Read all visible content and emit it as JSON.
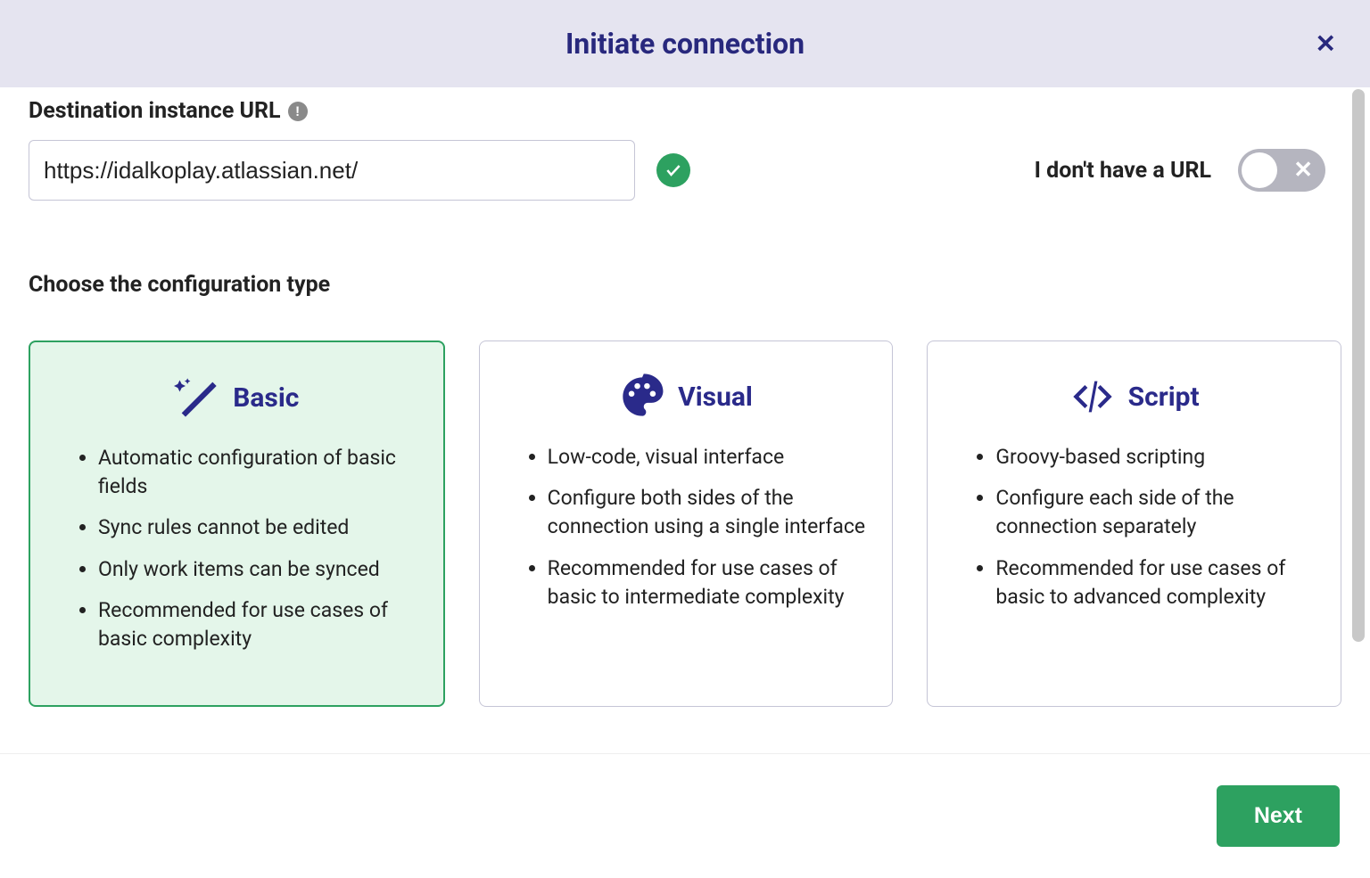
{
  "header": {
    "title": "Initiate connection"
  },
  "url_section": {
    "label": "Destination instance URL",
    "value": "https://idalkoplay.atlassian.net/",
    "no_url_label": "I don't have a URL"
  },
  "config_section": {
    "label": "Choose the configuration type"
  },
  "cards": {
    "basic": {
      "title": "Basic",
      "selected": true,
      "b1": "Automatic configuration of basic fields",
      "b2": "Sync rules cannot be edited",
      "b3": "Only work items can be synced",
      "b4": "Recommended for use cases of basic complexity"
    },
    "visual": {
      "title": "Visual",
      "b1": "Low-code, visual interface",
      "b2": "Configure both sides of the connection using a single interface",
      "b3": "Recommended for use cases of basic to intermediate complexity"
    },
    "script": {
      "title": "Script",
      "b1": "Groovy-based scripting",
      "b2": "Configure each side of the connection separately",
      "b3": "Recommended for use cases of basic to advanced complexity"
    }
  },
  "footer": {
    "next": "Next"
  }
}
